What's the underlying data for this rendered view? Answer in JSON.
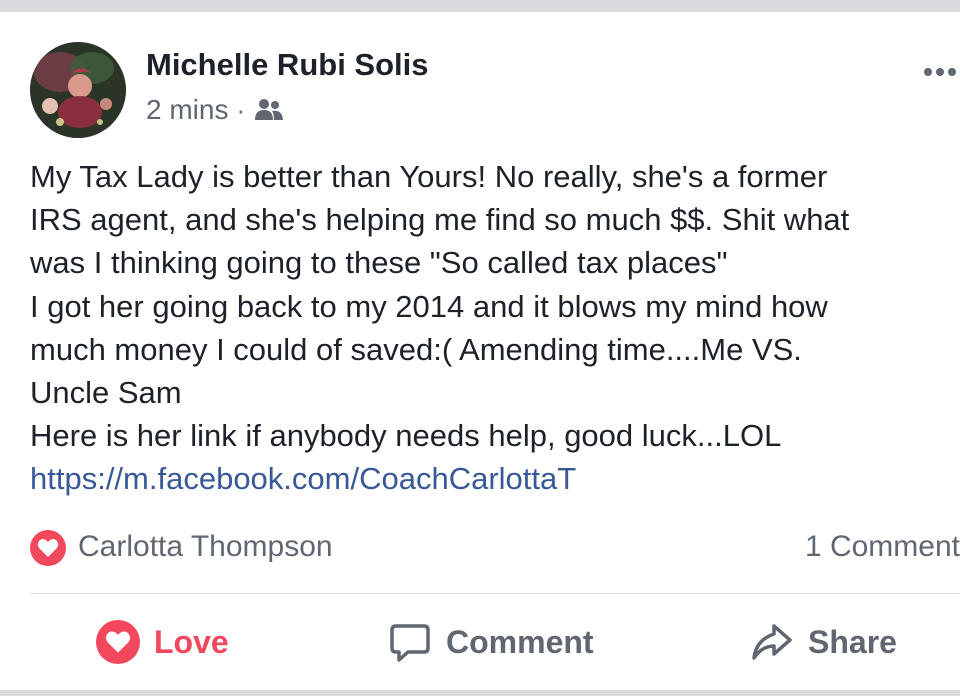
{
  "post": {
    "author_name": "Michelle Rubi Solis",
    "timestamp": "2 mins",
    "separator": "·",
    "audience_icon": "friends-icon",
    "menu_icon": "more-options-icon",
    "body_lines": [
      "My Tax Lady is better than Yours! No really, she's a former",
      "IRS agent, and she's helping me find so much $$. Shit what",
      "was I thinking going to these \"So called tax places\"",
      "I got her going back to my 2014 and it blows my mind how",
      "much money I could of saved:( Amending time....Me VS.",
      "Uncle Sam",
      "Here is her link if anybody needs help, good luck...LOL"
    ],
    "link": "https://m.facebook.com/CoachCarlottaT"
  },
  "reactions": {
    "reaction_icon": "love-reaction-icon",
    "reactor_name": "Carlotta Thompson",
    "comment_count": "1 Comment"
  },
  "actions": {
    "love_label": "Love",
    "comment_label": "Comment",
    "share_label": "Share"
  },
  "colors": {
    "love": "#f2485d",
    "link": "#385898",
    "text": "#1d2129",
    "secondary": "#606770",
    "frame": "#dadbdf"
  }
}
